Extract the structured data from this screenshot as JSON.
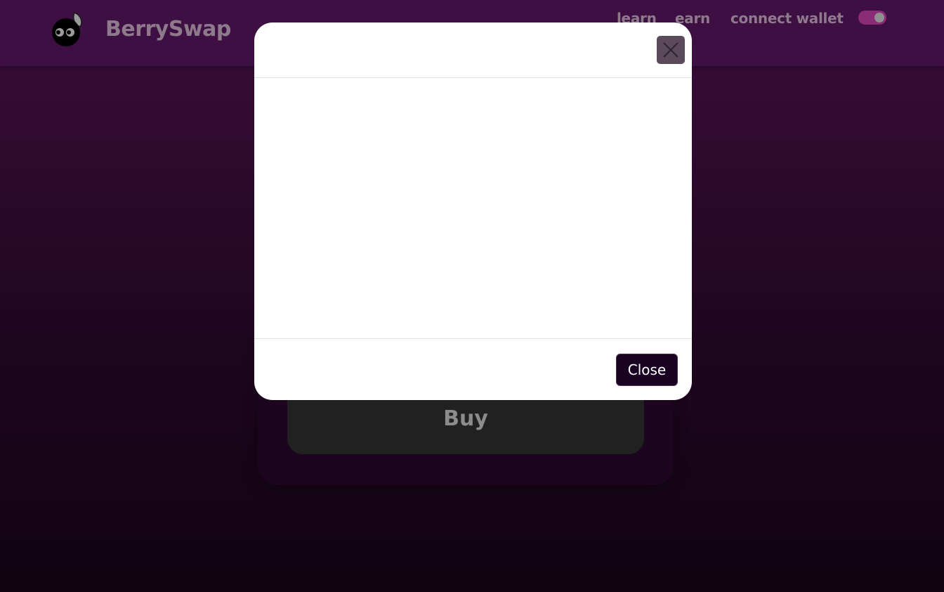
{
  "header": {
    "brand": "BerrySwap",
    "logo_icon": "berry-logo-icon",
    "nav": {
      "learn": "learn",
      "earn": "earn",
      "connect_wallet": "connect wallet"
    },
    "theme_toggle": {
      "state": "on",
      "accent": "#8a2c76"
    }
  },
  "swap_card": {
    "buy_label": "Buy"
  },
  "modal": {
    "close_icon": "close-icon",
    "footer": {
      "close_label": "Close"
    }
  },
  "colors": {
    "header_bg": "#3d0f42",
    "page_gradient_top": "#3a0c3a",
    "page_gradient_bottom": "#100410",
    "button_dark": "#1a0322"
  }
}
